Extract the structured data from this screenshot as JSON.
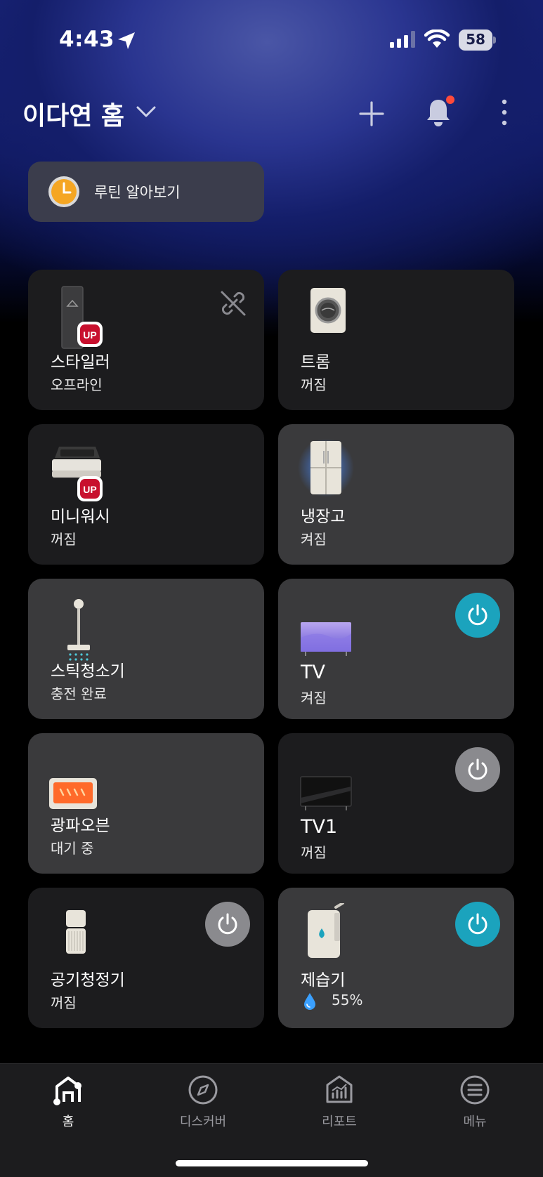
{
  "status_bar": {
    "time": "4:43",
    "battery": "58"
  },
  "header": {
    "home_name": "이다연 홈"
  },
  "routine": {
    "label": "루틴 알아보기"
  },
  "devices": [
    {
      "name": "스타일러",
      "state": "오프라인",
      "card": "off",
      "badge": "UP",
      "icon": "styler-icon",
      "status_icon": "unlink-icon"
    },
    {
      "name": "트롬",
      "state": "꺼짐",
      "card": "off",
      "icon": "washer-icon"
    },
    {
      "name": "미니워시",
      "state": "꺼짐",
      "card": "off",
      "badge": "UP",
      "icon": "mini-washer-icon"
    },
    {
      "name": "냉장고",
      "state": "켜짐",
      "card": "on",
      "icon": "refrigerator-icon"
    },
    {
      "name": "스틱청소기",
      "state": "충전 완료",
      "card": "on",
      "icon": "stick-vacuum-icon"
    },
    {
      "name": "TV",
      "state": "켜짐",
      "card": "on",
      "icon": "tv-icon",
      "power": "on"
    },
    {
      "name": "광파오븐",
      "state": "대기 중",
      "card": "on",
      "icon": "oven-icon"
    },
    {
      "name": "TV1",
      "state": "꺼짐",
      "card": "off",
      "icon": "tv-icon",
      "power": "off"
    },
    {
      "name": "공기청정기",
      "state": "꺼짐",
      "card": "off",
      "icon": "air-purifier-icon",
      "power": "off"
    },
    {
      "name": "제습기",
      "state": "55%",
      "card": "on",
      "icon": "dehumidifier-icon",
      "power": "on",
      "state_icon": "water-drop-icon"
    }
  ],
  "tabs": [
    {
      "label": "홈",
      "icon": "home-icon",
      "active": true
    },
    {
      "label": "디스커버",
      "icon": "compass-icon",
      "active": false
    },
    {
      "label": "리포트",
      "icon": "report-icon",
      "active": false
    },
    {
      "label": "메뉴",
      "icon": "menu-icon",
      "active": false
    }
  ],
  "colors": {
    "power_on": "#1ba3bd",
    "power_off": "#8a8a8e",
    "card_on": "#3a3a3c",
    "card_off": "#1c1c1e",
    "badge_red": "#c8102e"
  }
}
